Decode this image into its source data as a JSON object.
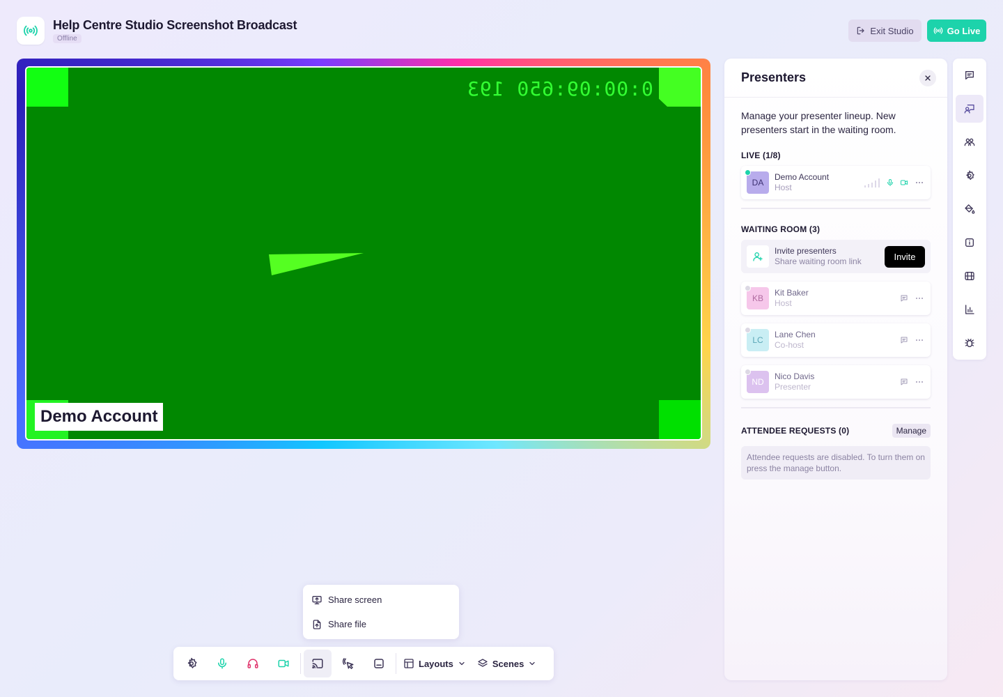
{
  "header": {
    "title": "Help Centre Studio Screenshot Broadcast",
    "status": "Offline",
    "exit_label": "Exit Studio",
    "golive_label": "Go Live"
  },
  "stage": {
    "timecode": "0:00:09:650 193",
    "name_tag": "Demo Account"
  },
  "share_menu": {
    "items": [
      {
        "label": "Share screen",
        "icon": "monitor-share-icon"
      },
      {
        "label": "Share file",
        "icon": "file-share-icon"
      }
    ]
  },
  "toolbar": {
    "buttons": [
      "settings-icon",
      "microphone-icon",
      "headphones-icon",
      "camera-icon",
      "cast-icon",
      "pointer-icon",
      "captions-icon"
    ],
    "layouts_label": "Layouts",
    "scenes_label": "Scenes"
  },
  "panel": {
    "title": "Presenters",
    "description": "Manage your presenter lineup. New presenters start in the waiting room.",
    "live_label": "LIVE (1/8)",
    "live": [
      {
        "initials": "DA",
        "name": "Demo Account",
        "role": "Host"
      }
    ],
    "waiting_label": "WAITING ROOM (3)",
    "invite": {
      "title": "Invite presenters",
      "subtitle": "Share waiting room link",
      "button": "Invite"
    },
    "waiting": [
      {
        "initials": "KB",
        "name": "Kit Baker",
        "role": "Host"
      },
      {
        "initials": "LC",
        "name": "Lane Chen",
        "role": "Co-host"
      },
      {
        "initials": "ND",
        "name": "Nico Davis",
        "role": "Presenter"
      }
    ],
    "requests_label": "ATTENDEE REQUESTS (0)",
    "manage_label": "Manage",
    "requests_note": "Attendee requests are disabled. To turn them on press the manage button."
  },
  "rail": {
    "icons": [
      "chat-icon",
      "presenters-icon",
      "people-icon",
      "gear-icon",
      "paint-bucket-icon",
      "info-icon",
      "film-icon",
      "chart-icon",
      "bug-icon"
    ]
  },
  "colors": {
    "accent": "#1dd3ab",
    "muted": "#8a7fa8",
    "danger": "#e0336b",
    "green_screen": "#018801"
  }
}
